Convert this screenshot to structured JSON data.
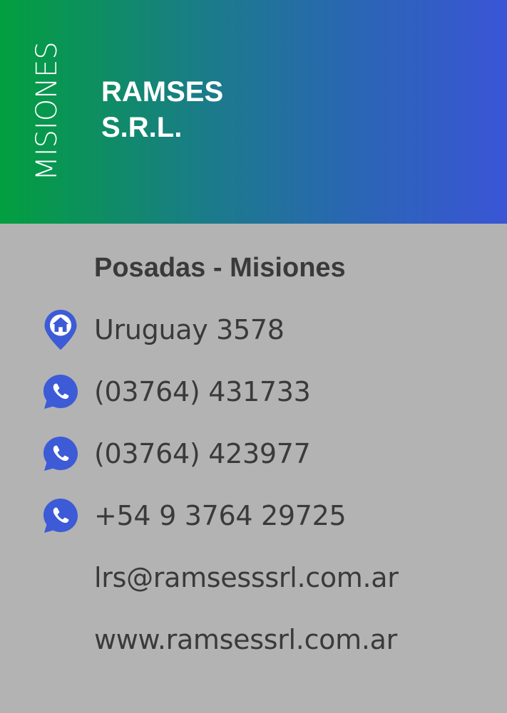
{
  "header": {
    "region": "MISIONES",
    "company_line1": "RAMSES",
    "company_line2": "S.R.L."
  },
  "contact": {
    "city": "Posadas - Misiones",
    "address": "Uruguay 3578",
    "phone1": "(03764) 431733",
    "phone2": "(03764) 423977",
    "phone3": "+54 9 3764 29725",
    "email": "lrs@ramsesssrl.com.ar",
    "website": "www.ramsessrl.com.ar"
  },
  "icons": {
    "address": "home-location-icon",
    "phone": "whatsapp-icon"
  },
  "colors": {
    "header_gradient_start": "#029f3e",
    "header_gradient_end": "#3a55d6",
    "body_background": "#b3b3b3",
    "icon_color": "#3d5bd6",
    "text_color": "#3a3a3a"
  }
}
